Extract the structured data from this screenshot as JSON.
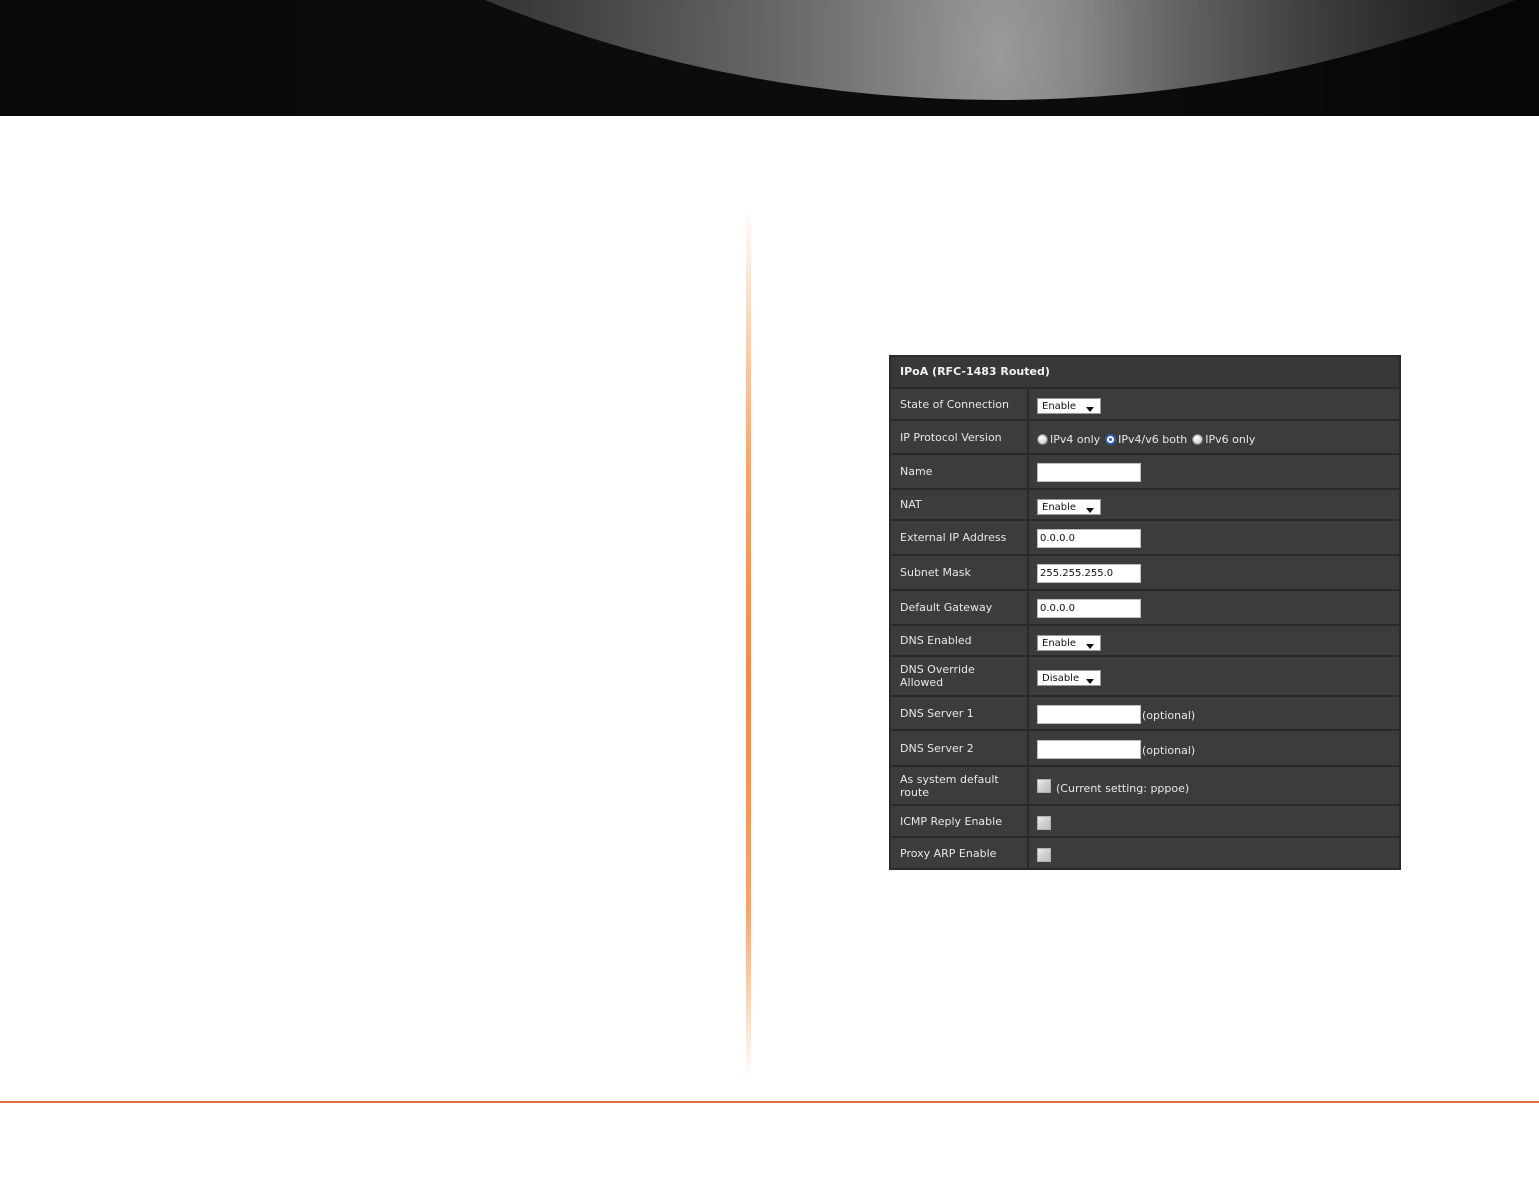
{
  "panel": {
    "title": "IPoA (RFC-1483 Routed)",
    "rows": {
      "state_of_connection": {
        "label": "State of Connection",
        "value": "Enable"
      },
      "ip_protocol_version": {
        "label": "IP Protocol Version",
        "options": [
          "IPv4 only",
          "IPv4/v6 both",
          "IPv6 only"
        ],
        "selected": "IPv4/v6 both"
      },
      "name": {
        "label": "Name",
        "value": ""
      },
      "nat": {
        "label": "NAT",
        "value": "Enable"
      },
      "external_ip": {
        "label": "External IP Address",
        "value": "0.0.0.0"
      },
      "subnet_mask": {
        "label": "Subnet Mask",
        "value": "255.255.255.0"
      },
      "default_gateway": {
        "label": "Default Gateway",
        "value": "0.0.0.0"
      },
      "dns_enabled": {
        "label": "DNS Enabled",
        "value": "Enable"
      },
      "dns_override": {
        "label_line1": "DNS Override",
        "label_line2": "Allowed",
        "value": "Disable"
      },
      "dns_server_1": {
        "label": "DNS Server 1",
        "value": "",
        "hint": "(optional)"
      },
      "dns_server_2": {
        "label": "DNS Server 2",
        "value": "",
        "hint": "(optional)"
      },
      "system_default_route": {
        "label_line1": "As system default",
        "label_line2": "route",
        "checked": false,
        "note": "(Current setting: pppoe)"
      },
      "icmp_reply": {
        "label": "ICMP Reply Enable",
        "checked": false
      },
      "proxy_arp": {
        "label": "Proxy ARP Enable",
        "checked": false
      }
    }
  },
  "colors": {
    "panel_bg": "#3c3c3c",
    "panel_border": "#2a2a2a",
    "accent_orange": "#e0743a",
    "banner_dark": "#0c0c0c"
  },
  "icons": {
    "select_arrow": "chevron-down-icon",
    "radio_checked": "radio-selected-icon",
    "radio_unchecked": "radio-unselected-icon"
  }
}
